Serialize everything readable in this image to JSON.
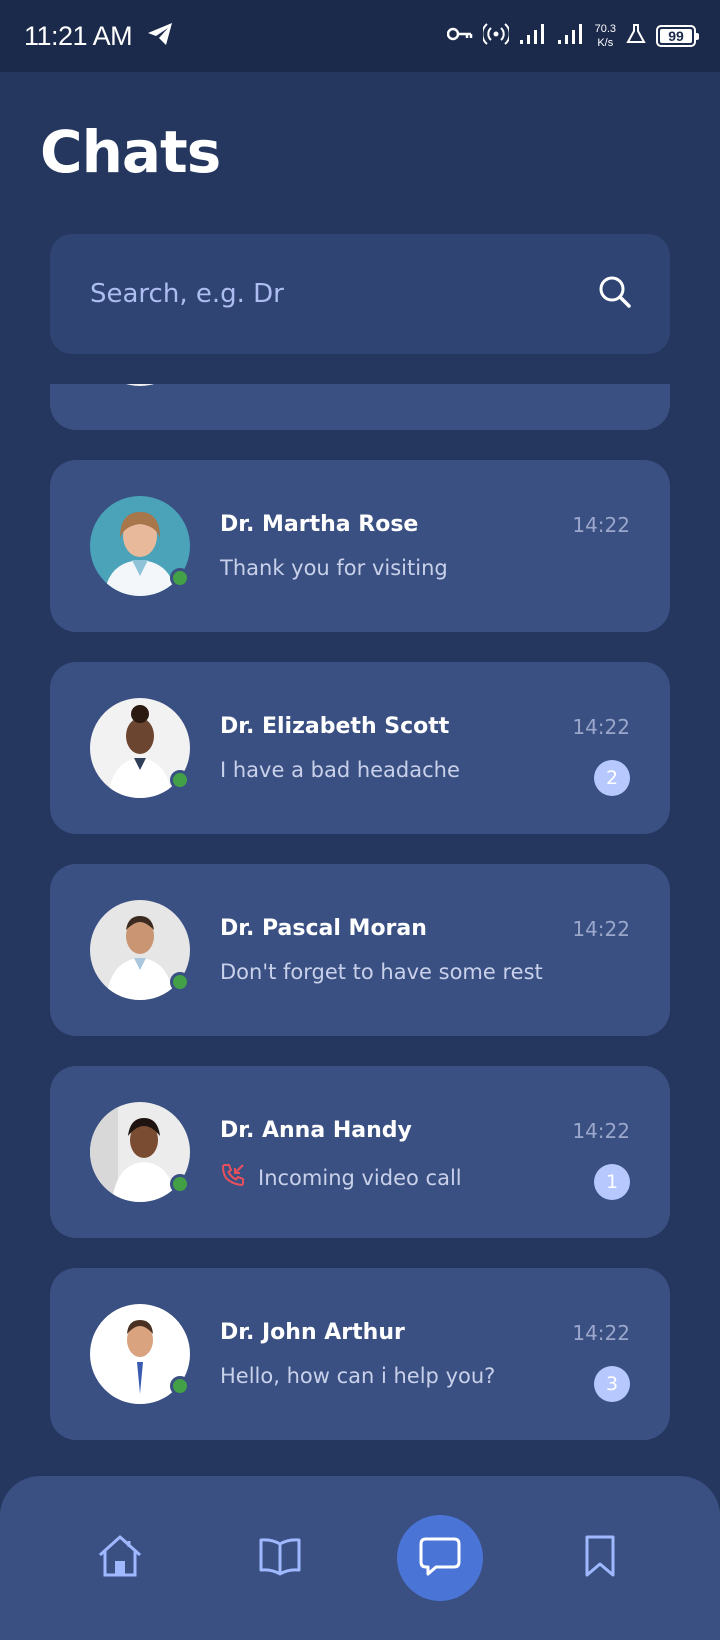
{
  "status_bar": {
    "time": "11:21 AM",
    "speed_value": "70.3",
    "speed_unit": "K/s",
    "battery": "99"
  },
  "page": {
    "title": "Chats"
  },
  "search": {
    "placeholder": "Search, e.g. Dr"
  },
  "chats": [
    {
      "name": "Dr. Martha Rose",
      "message": "Thank you for visiting",
      "time": "14:22",
      "unread": "",
      "online": true,
      "avatar_bg": "#4aa3b8"
    },
    {
      "name": "Dr. Elizabeth Scott",
      "message": "I have a bad headache",
      "time": "14:22",
      "unread": "2",
      "online": true,
      "avatar_bg": "#f2f2f2"
    },
    {
      "name": "Dr. Pascal Moran",
      "message": "Don't forget to have some rest",
      "time": "14:22",
      "unread": "",
      "online": true,
      "avatar_bg": "#e6e6e6"
    },
    {
      "name": "Dr. Anna Handy",
      "message": "Incoming video call",
      "time": "14:22",
      "unread": "1",
      "online": true,
      "avatar_bg": "#ececec",
      "message_icon": "missed-call-icon"
    },
    {
      "name": "Dr. John Arthur",
      "message": "Hello, how can i help you?",
      "time": "14:22",
      "unread": "3",
      "online": true,
      "avatar_bg": "#ffffff"
    }
  ],
  "nav": {
    "items": [
      "home-icon",
      "book-icon",
      "chat-icon",
      "bookmark-icon"
    ],
    "active": "chat-icon"
  },
  "colors": {
    "background": "#25375f",
    "card": "#3a5082",
    "accent": "#4a74d6",
    "online": "#43a047",
    "badge": "#b7c8ff",
    "missed_call": "#e8505b"
  }
}
